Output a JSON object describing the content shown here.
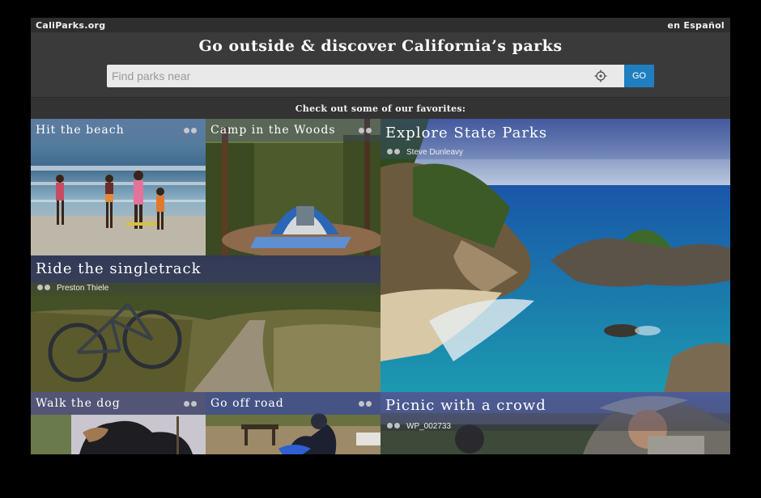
{
  "header": {
    "brand": "CaliParks.org",
    "language_link": "en Español"
  },
  "hero": {
    "title": "Go outside & discover California’s parks",
    "search_placeholder": "Find parks near",
    "search_value": "",
    "go_label": "GO",
    "locate_icon": "crosshair-icon"
  },
  "favorites_heading": "Check out some of our favorites:",
  "tiles": [
    {
      "title": "Hit the beach",
      "credit": ""
    },
    {
      "title": "Camp in the Woods",
      "credit": ""
    },
    {
      "title": "Explore State Parks",
      "credit": "Steve Dunleavy"
    },
    {
      "title": "Ride the singletrack",
      "credit": "Preston Thiele"
    },
    {
      "title": "Walk the dog",
      "credit": ""
    },
    {
      "title": "Go off road",
      "credit": ""
    },
    {
      "title": "Picnic with a crowd",
      "credit": "WP_002733"
    }
  ],
  "colors": {
    "accent": "#1f7fc0",
    "page_bg": "#3a3a3a",
    "frame": "#000000"
  }
}
